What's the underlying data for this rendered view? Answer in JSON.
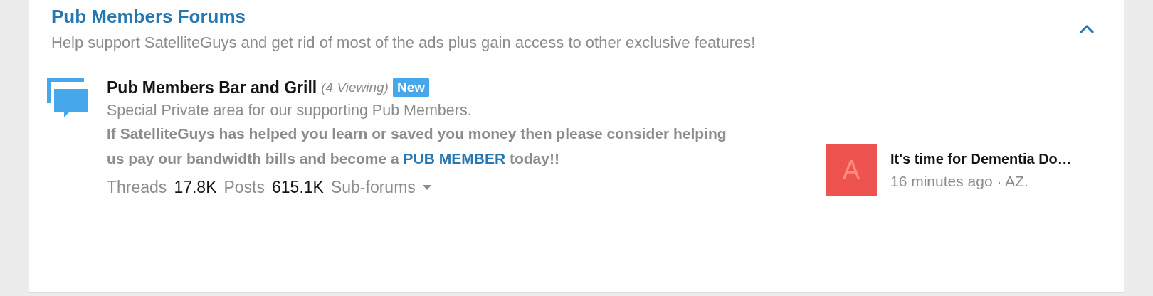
{
  "category": {
    "title": "Pub Members Forums",
    "description": "Help support SatelliteGuys and get rid of most of the ads plus gain access to other exclusive features!",
    "expanded": true
  },
  "forum": {
    "title": "Pub Members Bar and Grill",
    "viewing": "(4 Viewing)",
    "badge": "New",
    "description": "Special Private area for our supporting Pub Members.",
    "promo": {
      "before": "If SatelliteGuys has helped you learn or saved you money then please consider helping us pay our bandwidth bills and become a ",
      "link": "PUB MEMBER",
      "after": " today!!"
    },
    "stats": [
      {
        "label": "Threads",
        "value": "17.8K"
      },
      {
        "label": "Posts",
        "value": "615.1K"
      }
    ],
    "subforums": "Sub-forums",
    "last_post": {
      "avatar_letter": "A",
      "color": "#ef5350",
      "title": "It's time for Dementia Do…",
      "meta": "16 minutes ago · AZ."
    }
  }
}
